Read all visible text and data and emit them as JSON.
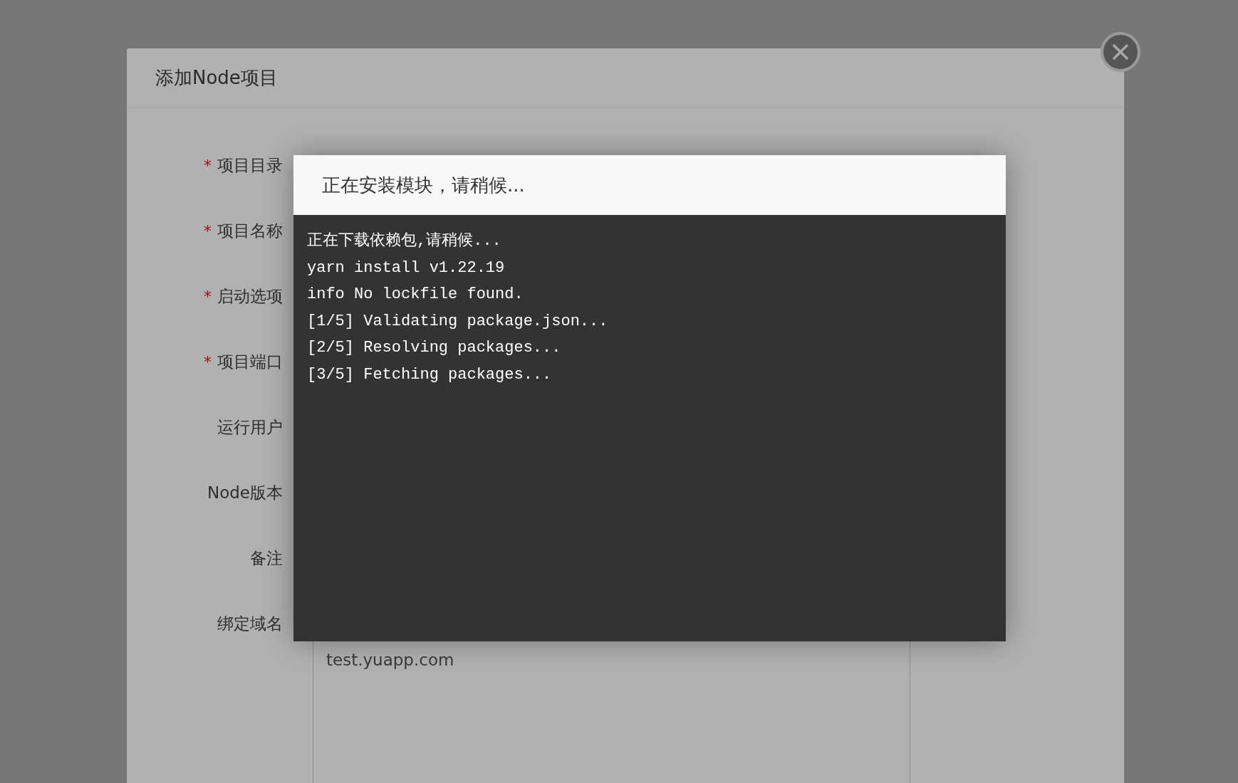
{
  "modal": {
    "title": "添加Node项目",
    "fields": [
      {
        "label": "项目目录",
        "required_mark": "*"
      },
      {
        "label": "项目名称",
        "required_mark": "*"
      },
      {
        "label": "启动选项",
        "required_mark": "*"
      },
      {
        "label": "项目端口",
        "required_mark": "*"
      },
      {
        "label": "运行用户"
      },
      {
        "label": "Node版本"
      },
      {
        "label": "备注"
      },
      {
        "label": "绑定域名",
        "kind": "textarea",
        "value": "test.yuapp.com"
      }
    ]
  },
  "progress_dialog": {
    "title": "正在安装模块，请稍候...",
    "log_lines": [
      "正在下载依赖包,请稍候...",
      "yarn install v1.22.19",
      "info No lockfile found.",
      "[1/5] Validating package.json...",
      "[2/5] Resolving packages...",
      "[3/5] Fetching packages..."
    ]
  }
}
